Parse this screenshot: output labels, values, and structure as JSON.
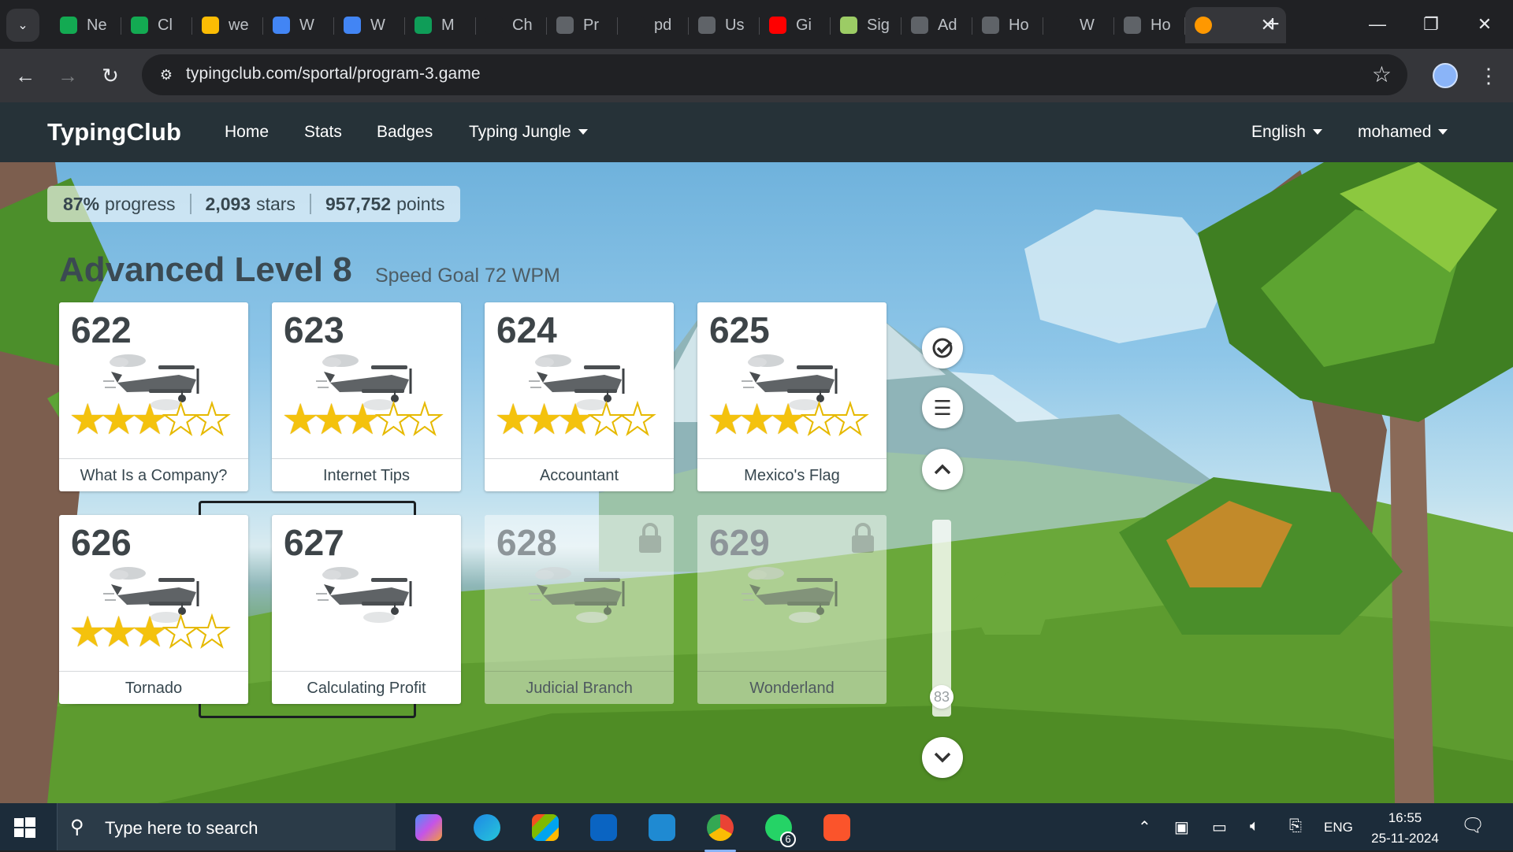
{
  "browser": {
    "tabs": [
      {
        "label": "Ne",
        "icon": "green-leaf-icon",
        "color": "#13aa52"
      },
      {
        "label": "Cl",
        "icon": "green-leaf-icon",
        "color": "#13aa52"
      },
      {
        "label": "we",
        "icon": "google-drive-icon",
        "color": "#fbbc04"
      },
      {
        "label": "W",
        "icon": "google-docs-icon",
        "color": "#4285f4"
      },
      {
        "label": "W",
        "icon": "google-docs-icon",
        "color": "#4285f4"
      },
      {
        "label": "M",
        "icon": "google-sheets-icon",
        "color": "#0f9d58"
      },
      {
        "label": "Ch",
        "icon": "openai-icon",
        "color": "#202124"
      },
      {
        "label": "Pr",
        "icon": "loading-icon",
        "color": "#5f6368"
      },
      {
        "label": "pd",
        "icon": "github-icon",
        "color": "#202124"
      },
      {
        "label": "Us",
        "icon": "globe-icon",
        "color": "#5f6368"
      },
      {
        "label": "Gi",
        "icon": "youtube-icon",
        "color": "#ff0000"
      },
      {
        "label": "Sig",
        "icon": "sign-icon",
        "color": "#9ccc65"
      },
      {
        "label": "Ad",
        "icon": "loading-icon",
        "color": "#5f6368"
      },
      {
        "label": "Ho",
        "icon": "loading-icon",
        "color": "#5f6368"
      },
      {
        "label": "W",
        "icon": "github-icon",
        "color": "#202124"
      },
      {
        "label": "Ho",
        "icon": "loading-icon",
        "color": "#5f6368"
      }
    ],
    "active_tab_icon": "typingclub-icon",
    "url": "typingclub.com/sportal/program-3.game"
  },
  "site": {
    "brand": "TypingClub",
    "nav": [
      "Home",
      "Stats",
      "Badges",
      "Typing Jungle"
    ],
    "language": "English",
    "user": "mohamed"
  },
  "progress": {
    "percent": "87%",
    "percent_label": "progress",
    "stars": "2,093",
    "stars_label": "stars",
    "points": "957,752",
    "points_label": "points"
  },
  "level": {
    "title": "Advanced Level 8",
    "speed_goal": "Speed Goal 72 WPM"
  },
  "lessons": [
    {
      "number": "622",
      "name": "What Is a Company?",
      "stars": 3,
      "max_stars": 5,
      "locked": false
    },
    {
      "number": "623",
      "name": "Internet Tips",
      "stars": 3,
      "max_stars": 5,
      "locked": false
    },
    {
      "number": "624",
      "name": "Accountant",
      "stars": 3,
      "max_stars": 5,
      "locked": false
    },
    {
      "number": "625",
      "name": "Mexico's Flag",
      "stars": 3,
      "max_stars": 5,
      "locked": false
    },
    {
      "number": "626",
      "name": "Tornado",
      "stars": 3,
      "max_stars": 5,
      "locked": false
    },
    {
      "number": "627",
      "name": "Calculating Profit",
      "stars": 0,
      "max_stars": 5,
      "locked": false,
      "selected": true
    },
    {
      "number": "628",
      "name": "Judicial Branch",
      "stars": 0,
      "max_stars": 5,
      "locked": true
    },
    {
      "number": "629",
      "name": "Wonderland",
      "stars": 0,
      "max_stars": 5,
      "locked": true
    }
  ],
  "scroller": {
    "position": "83"
  },
  "taskbar": {
    "search_placeholder": "Type here to search",
    "apps": [
      "copilot-icon",
      "edge-icon",
      "store-icon",
      "outlook-icon",
      "vscode-icon",
      "chrome-icon",
      "whatsapp-icon",
      "brave-icon"
    ],
    "whatsapp_badge": "6",
    "language": "ENG",
    "time": "16:55",
    "date": "25-11-2024"
  }
}
